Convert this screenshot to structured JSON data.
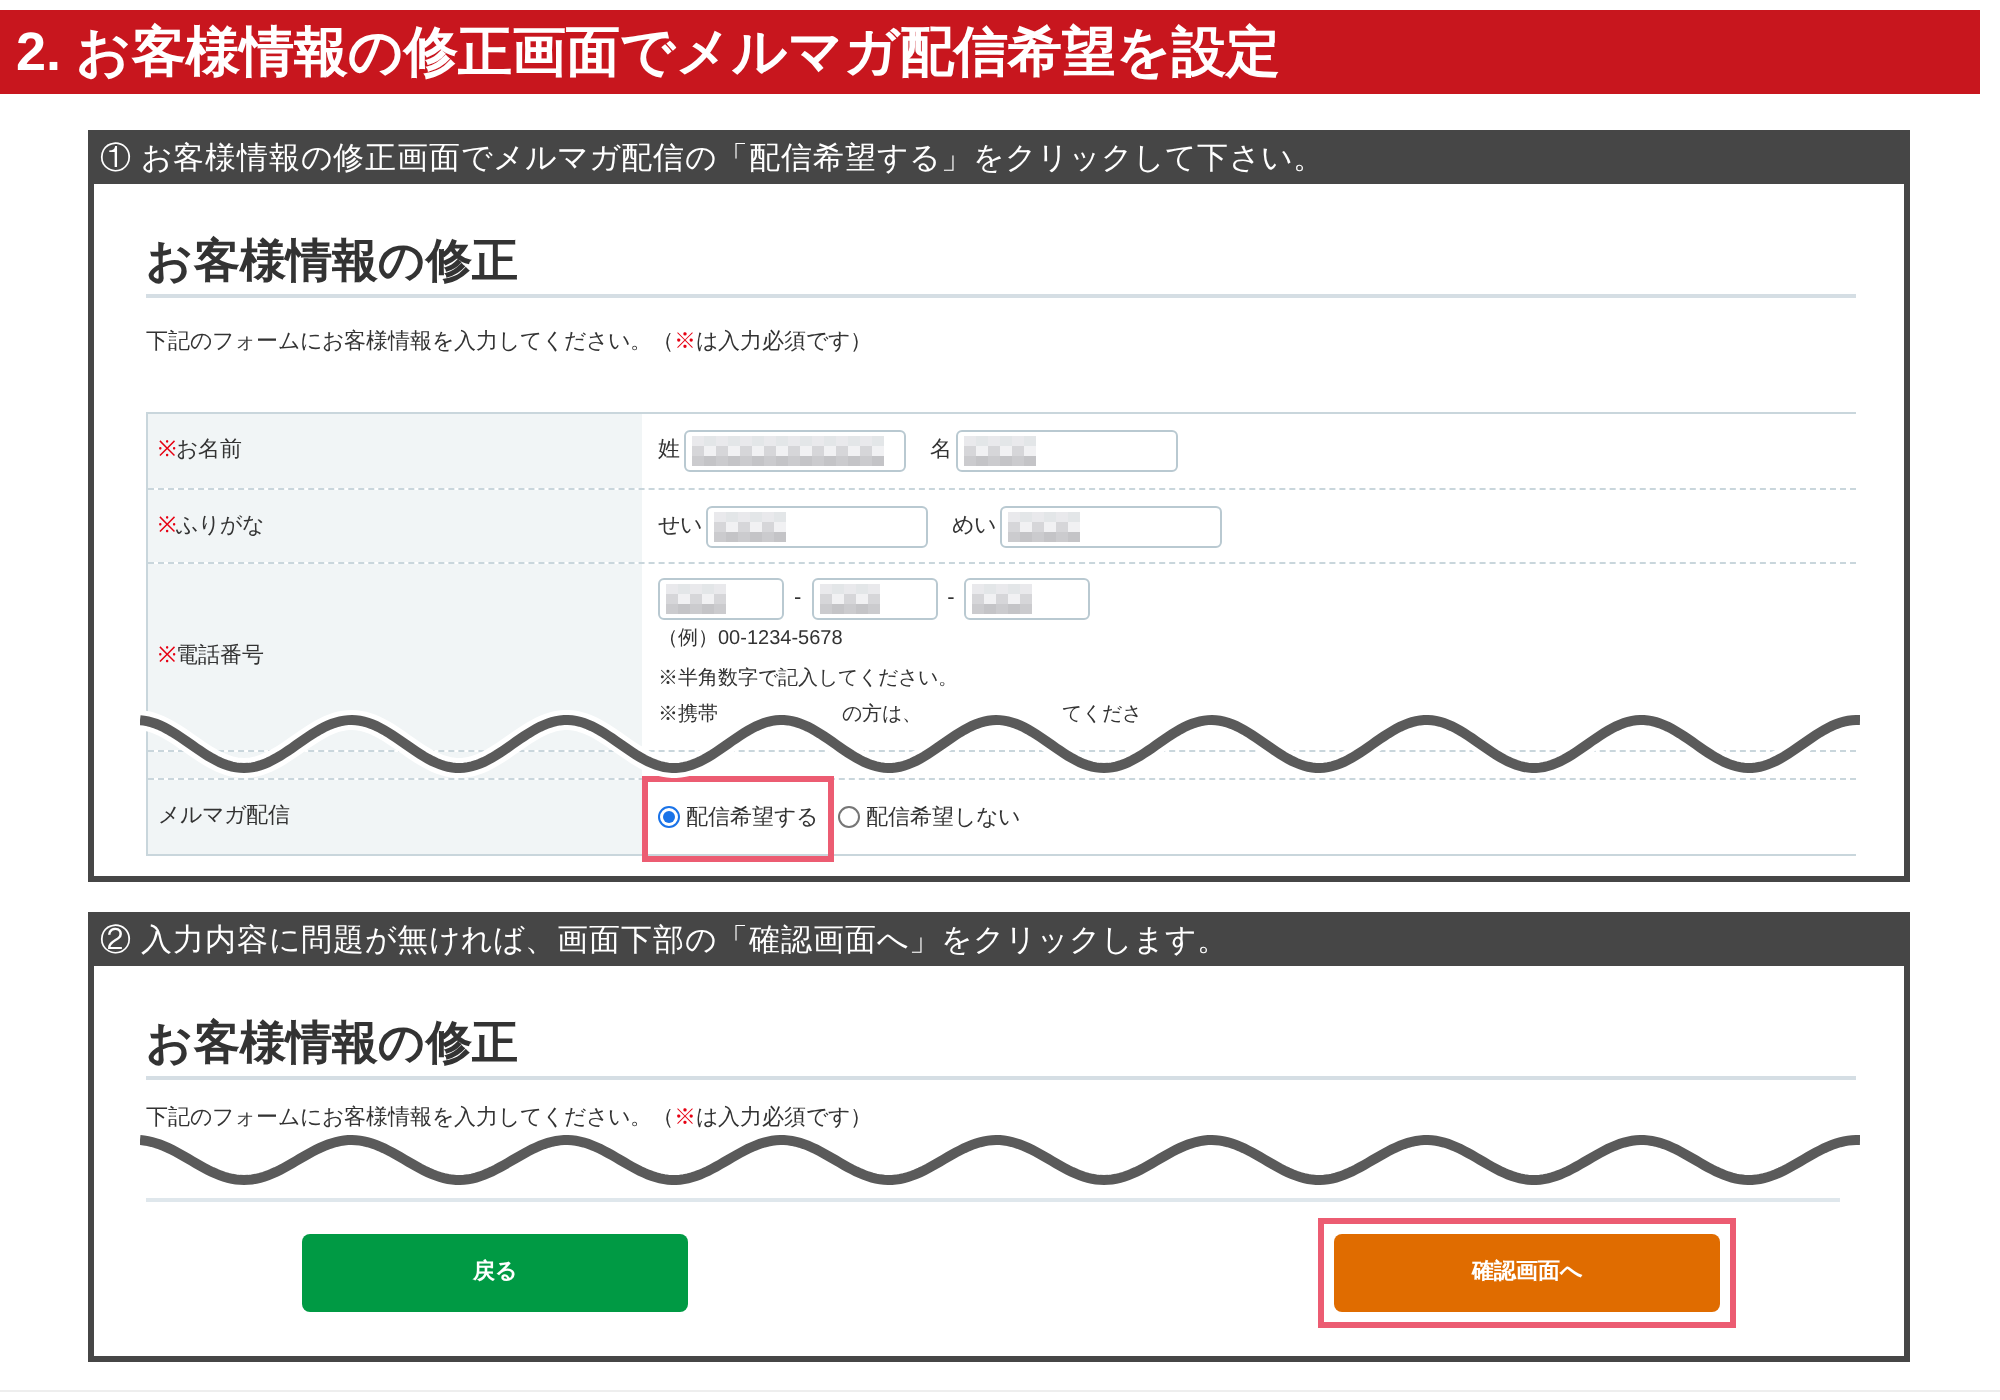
{
  "banner": {
    "title": "2. お客様情報の修正画面でメルマガ配信希望を設定"
  },
  "steps": [
    {
      "caption": "① お客様情報の修正画面でメルマガ配信の「配信希望する」をクリックして下さい。",
      "form": {
        "title": "お客様情報の修正",
        "description": {
          "before": "下記のフォームにお客様情報を入力してください。（",
          "mark": "※",
          "after": "は入力必須です）"
        },
        "rows": [
          {
            "kind": "text_pair",
            "mark": "※",
            "label": "お名前",
            "inputs": [
              {
                "prefix": "姓",
                "redacted": true
              },
              {
                "prefix": "名",
                "redacted": true
              }
            ]
          },
          {
            "kind": "text_pair",
            "mark": "※",
            "label": "ふりがな",
            "inputs": [
              {
                "prefix": "せい",
                "redacted": true
              },
              {
                "prefix": "めい",
                "redacted": true
              }
            ]
          },
          {
            "kind": "phone",
            "mark": "※",
            "label": "電話番号",
            "inputs": [
              {
                "redacted": true
              },
              {
                "prefix": "-",
                "redacted": true
              },
              {
                "prefix": "-",
                "redacted": true
              }
            ],
            "notes": [
              "（例）00-1234-5678",
              "※半角数字で記入してください。"
            ],
            "cut_note": [
              "※携帯",
              "の方は、",
              "てくださ"
            ]
          },
          {
            "kind": "radio",
            "label": "メルマガ配信",
            "options": [
              {
                "label": "配信希望する",
                "selected": true,
                "highlighted": true
              },
              {
                "label": "配信希望しない",
                "selected": false,
                "highlighted": false
              }
            ]
          }
        ]
      }
    },
    {
      "caption": "② 入力内容に問題が無ければ、画面下部の「確認画面へ」をクリックします。",
      "form": {
        "title": "お客様情報の修正",
        "description": {
          "before": "下記のフォームにお客様情報を入力してください。（",
          "mark": "※",
          "after": "は入力必須です）"
        },
        "buttons": [
          {
            "kind": "back",
            "label": "戻る",
            "highlighted": false
          },
          {
            "kind": "confirm",
            "label": "確認画面へ",
            "highlighted": true
          }
        ]
      }
    }
  ]
}
